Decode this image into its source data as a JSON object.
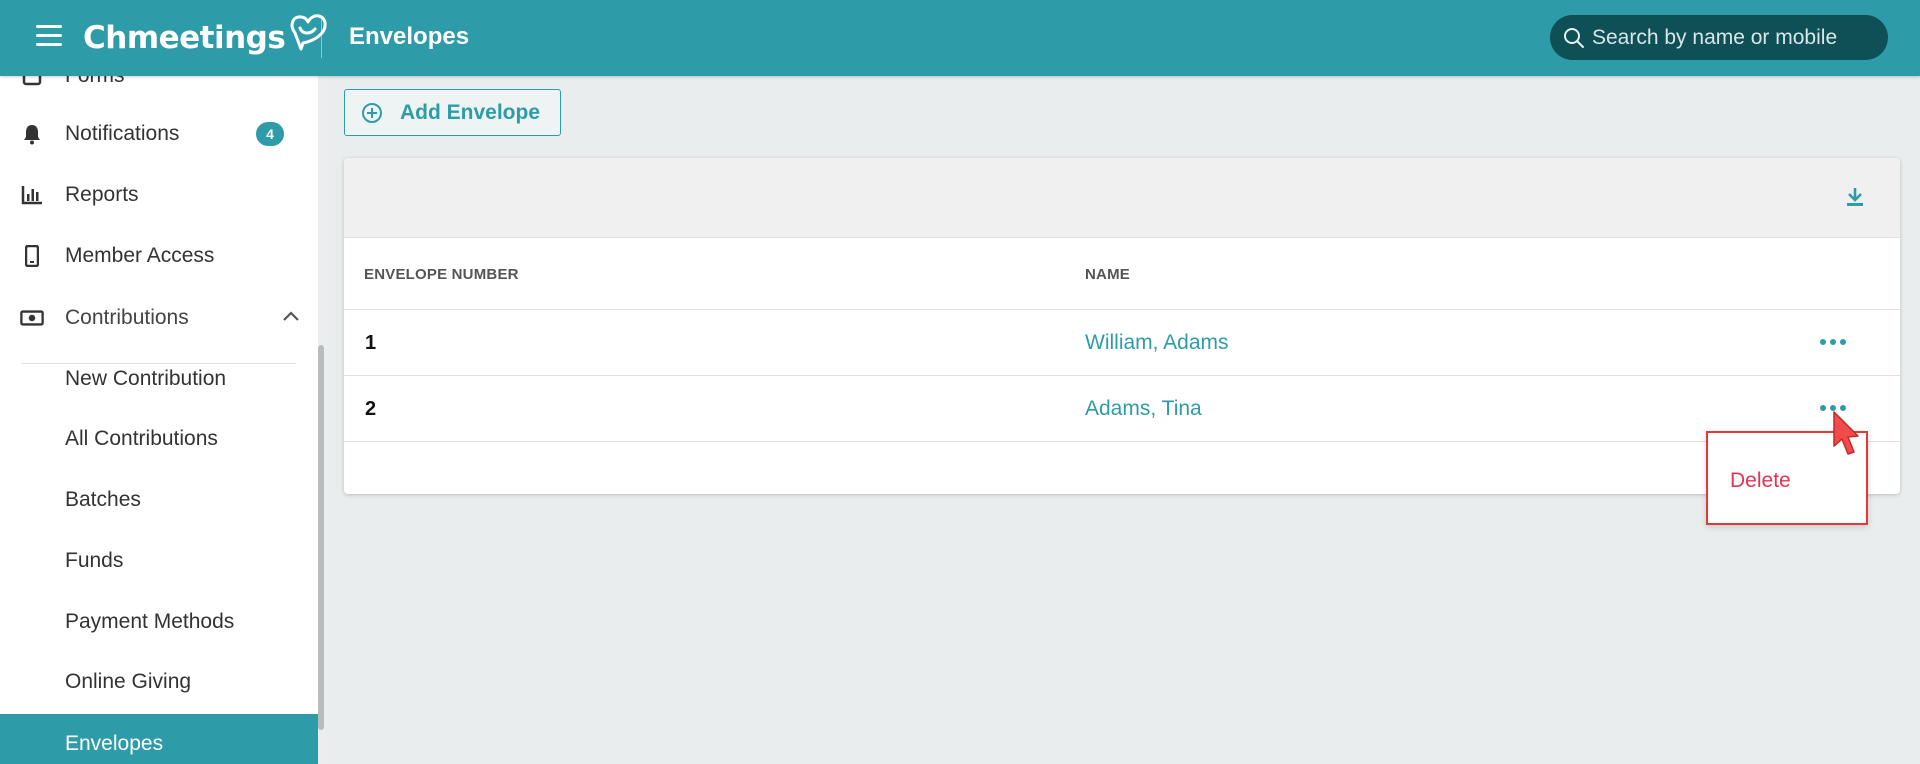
{
  "header": {
    "logo_text": "Chmeetings",
    "page_title": "Envelopes",
    "search_placeholder": "Search by name or mobile"
  },
  "sidebar": {
    "items": [
      {
        "label": "Forms",
        "icon": "forms-icon"
      },
      {
        "label": "Notifications",
        "icon": "bell-icon",
        "badge": "4"
      },
      {
        "label": "Reports",
        "icon": "bar-chart-icon"
      },
      {
        "label": "Member Access",
        "icon": "mobile-icon"
      },
      {
        "label": "Contributions",
        "icon": "money-icon",
        "expanded": true
      }
    ],
    "sub_items": [
      {
        "label": "New Contribution"
      },
      {
        "label": "All Contributions"
      },
      {
        "label": "Batches"
      },
      {
        "label": "Funds"
      },
      {
        "label": "Payment Methods"
      },
      {
        "label": "Online Giving"
      },
      {
        "label": "Envelopes",
        "active": true
      }
    ]
  },
  "toolbar": {
    "add_label": "Add Envelope"
  },
  "table": {
    "columns": [
      "ENVELOPE NUMBER",
      "NAME"
    ],
    "rows": [
      {
        "number": "1",
        "name": "William, Adams"
      },
      {
        "number": "2",
        "name": "Adams, Tina"
      }
    ]
  },
  "context_menu": {
    "delete_label": "Delete"
  },
  "colors": {
    "primary": "#2e9ca8",
    "search_bg": "#0f4f56",
    "danger": "#e53353",
    "highlight": "#e53935"
  }
}
